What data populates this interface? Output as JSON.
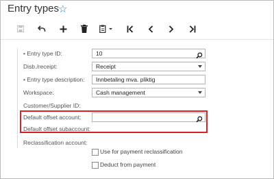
{
  "header": {
    "title": "Entry types"
  },
  "form": {
    "entry_type_id": {
      "label": "Entry type ID:",
      "value": "10"
    },
    "disb_receipt": {
      "label": "Disb./receipt:",
      "value": "Receipt"
    },
    "entry_type_description": {
      "label": "Entry type description:",
      "value": "Innbetaling mva. pliktig"
    },
    "workspace": {
      "label": "Workspace:",
      "value": "Cash management"
    },
    "customer_supplier_id": {
      "label": "Customer/Supplier ID:"
    },
    "default_offset_account": {
      "label": "Default offset account:",
      "value": ""
    },
    "default_offset_subaccount": {
      "label": "Default offset subaccount:"
    },
    "reclassification_account": {
      "label": "Reclassification account:"
    },
    "use_for_payment_reclassification": {
      "label": "Use for payment reclassification",
      "checked": false
    },
    "deduct_from_payment": {
      "label": "Deduct from payment",
      "checked": false
    }
  },
  "colors": {
    "accent": "#2f80c4",
    "highlight": "#e02020"
  }
}
